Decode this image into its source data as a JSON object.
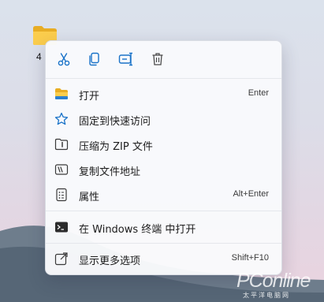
{
  "desktop": {
    "folder_label": "4",
    "folder_icon": "folder-icon"
  },
  "quick_actions": [
    {
      "icon": "cut-icon"
    },
    {
      "icon": "copy-icon"
    },
    {
      "icon": "rename-icon"
    },
    {
      "icon": "delete-icon"
    }
  ],
  "menu": {
    "items": [
      {
        "label": "打开",
        "shortcut": "Enter",
        "icon": "folder-open-icon"
      },
      {
        "label": "固定到快速访问",
        "shortcut": "",
        "icon": "star-icon"
      },
      {
        "label": "压缩为 ZIP 文件",
        "shortcut": "",
        "icon": "zip-icon"
      },
      {
        "label": "复制文件地址",
        "shortcut": "",
        "icon": "copy-path-icon"
      },
      {
        "label": "属性",
        "shortcut": "Alt+Enter",
        "icon": "properties-icon"
      },
      {
        "label": "在 Windows 终端 中打开",
        "shortcut": "",
        "icon": "terminal-icon"
      },
      {
        "label": "显示更多选项",
        "shortcut": "Shift+F10",
        "icon": "more-options-icon"
      }
    ]
  },
  "watermark": {
    "brand": "PConline",
    "sub": "太平洋电脑网"
  },
  "colors": {
    "accent": "#1a73c8",
    "folder": "#f5c342",
    "menu_bg": "#f9fafc"
  }
}
